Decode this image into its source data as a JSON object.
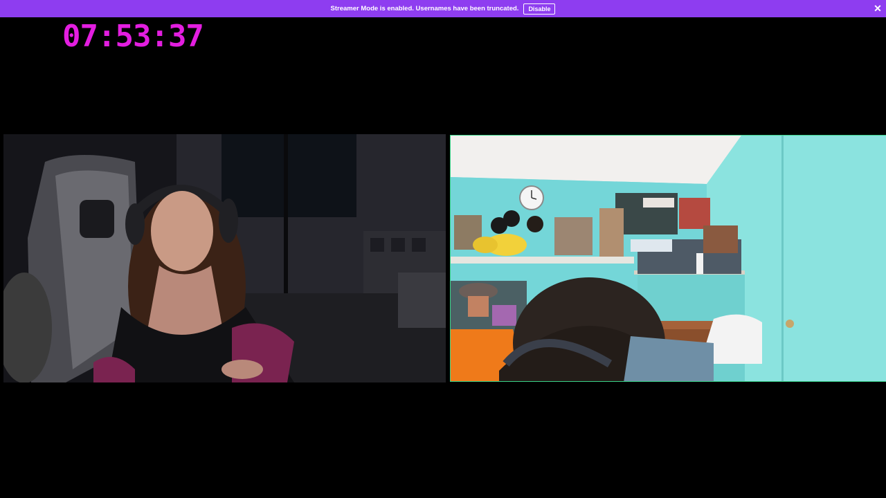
{
  "banner": {
    "message": "Streamer Mode is enabled. Usernames have been truncated.",
    "disable_label": "Disable",
    "close_icon": "close-icon",
    "color": "#8e3df0"
  },
  "timer": {
    "value": "07:53:37",
    "color": "#e31ee0"
  },
  "videos": {
    "left": {
      "description_icon": "webcam-feed"
    },
    "right": {
      "description_icon": "webcam-feed",
      "border_color": "#3ad58a"
    }
  }
}
